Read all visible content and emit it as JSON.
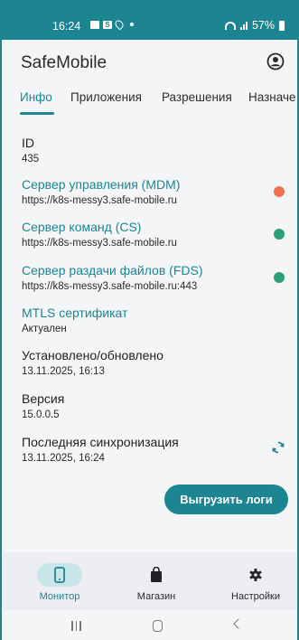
{
  "status_bar": {
    "time": "16:24",
    "battery": "57%"
  },
  "app": {
    "title": "SafeMobile"
  },
  "tabs": [
    {
      "label": "Инфо",
      "active": true
    },
    {
      "label": "Приложения",
      "active": false
    },
    {
      "label": "Разрешения",
      "active": false
    },
    {
      "label": "Назначе",
      "active": false
    }
  ],
  "info": {
    "id": {
      "label": "ID",
      "value": "435"
    },
    "mdm": {
      "label": "Сервер управления (MDM)",
      "value": "https://k8s-messy3.safe-mobile.ru",
      "status_color": "#f0704f"
    },
    "cs": {
      "label": "Сервер команд (CS)",
      "value": "https://k8s-messy3.safe-mobile.ru",
      "status_color": "#2e9e7a"
    },
    "fds": {
      "label": "Сервер раздачи файлов (FDS)",
      "value": "https://k8s-messy3.safe-mobile.ru:443",
      "status_color": "#2e9e7a"
    },
    "mtls": {
      "label": "MTLS сертификат",
      "value": "Актуален"
    },
    "installed": {
      "label": "Установлено/обновлено",
      "value": "13.11.2025, 16:13"
    },
    "version": {
      "label": "Версия",
      "value": "15.0.0.5"
    },
    "last_sync": {
      "label": "Последняя синхронизация",
      "value": "13.11.2025, 16:24"
    }
  },
  "actions": {
    "upload_logs": "Выгрузить логи"
  },
  "bottom_nav": [
    {
      "label": "Монитор",
      "icon": "phone-icon",
      "active": true
    },
    {
      "label": "Магазин",
      "icon": "shopping-bag-icon",
      "active": false
    },
    {
      "label": "Настройки",
      "icon": "gear-icon",
      "active": false
    }
  ],
  "colors": {
    "accent": "#1d8591",
    "status_red": "#f0704f",
    "status_green": "#2e9e7a"
  }
}
